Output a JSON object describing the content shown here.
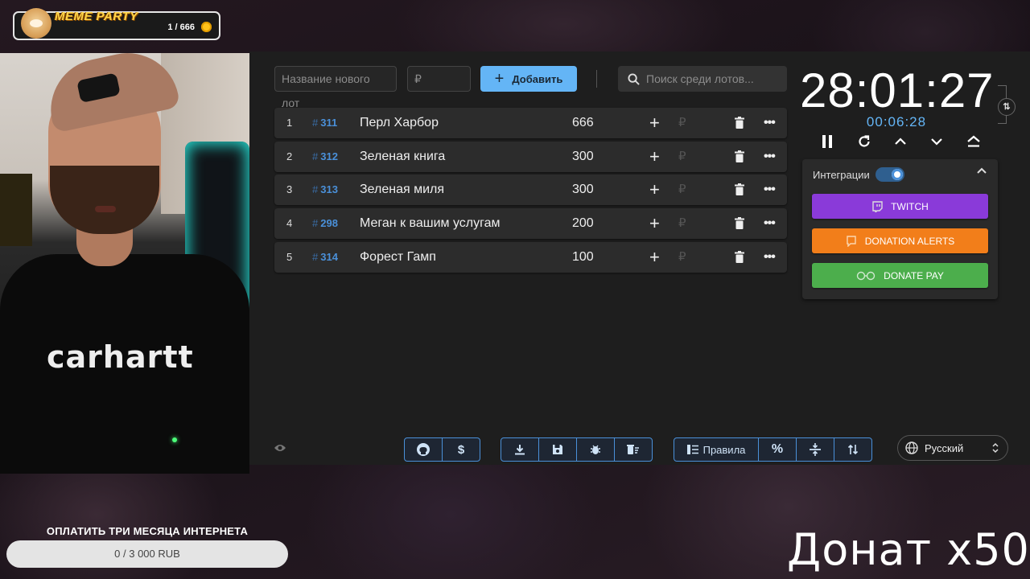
{
  "meme_widget": {
    "title": "MEME PARTY",
    "count": "1 / 666"
  },
  "webcam": {
    "shirt_brand": "carhartt"
  },
  "form": {
    "new_lot_placeholder": "Название нового лот",
    "amount_placeholder": "₽",
    "add_label": "Добавить",
    "search_placeholder": "Поиск среди лотов..."
  },
  "lots": [
    {
      "index": "1",
      "id": "311",
      "name": "Перл Харбор",
      "amount": "666"
    },
    {
      "index": "2",
      "id": "312",
      "name": "Зеленая книга",
      "amount": "300"
    },
    {
      "index": "3",
      "id": "313",
      "name": "Зеленая миля",
      "amount": "300"
    },
    {
      "index": "4",
      "id": "298",
      "name": "Меган к вашим услугам",
      "amount": "200"
    },
    {
      "index": "5",
      "id": "314",
      "name": "Форест Гамп",
      "amount": "100"
    }
  ],
  "lot_symbols": {
    "hash": "#",
    "plus": "+",
    "rub": "₽",
    "more": "•••"
  },
  "timer": {
    "main": "28:01:27",
    "secondary": "00:06:28"
  },
  "integrations": {
    "label": "Интеграции",
    "enabled": true,
    "buttons": [
      {
        "label": "TWITCH",
        "color": "#8a3ad9"
      },
      {
        "label": "DONATION ALERTS",
        "color": "#f27e1a"
      },
      {
        "label": "DONATE PAY",
        "color": "#4cae4c"
      }
    ]
  },
  "toolbar": {
    "rules_label": "Правила",
    "dollar_label": "$",
    "percent_label": "%"
  },
  "language": {
    "selected": "Русский"
  },
  "goal": {
    "title": "ОПЛАТИТЬ ТРИ МЕСЯЦА ИНТЕРНЕТА",
    "progress": "0 / 3 000 RUB"
  },
  "overlay": {
    "donat_text": "Донат x50"
  },
  "colors": {
    "accent": "#64b5f6",
    "lot_id": "#4a90d9",
    "panel": "#1e1e1e",
    "lot_row": "#2c2c2c"
  }
}
